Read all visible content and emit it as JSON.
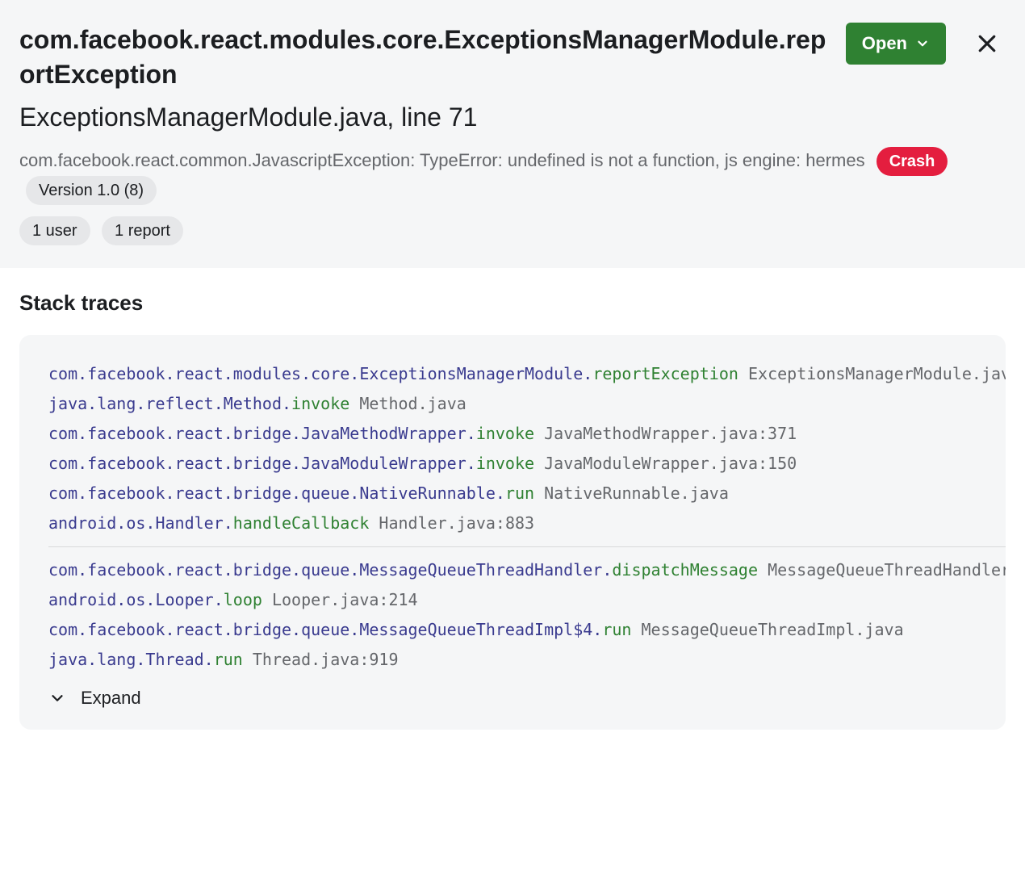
{
  "header": {
    "title": "com.facebook.react.modules.core.ExceptionsManagerModule.reportException",
    "location": "ExceptionsManagerModule.java, line 71",
    "description": "com.facebook.react.common.JavascriptException: TypeError: undefined is not a function, js engine: hermes",
    "status_button": "Open",
    "badges": {
      "crash": "Crash",
      "version": "Version 1.0 (8)"
    },
    "meta": {
      "users": "1 user",
      "reports": "1 report"
    }
  },
  "stack": {
    "heading": "Stack traces",
    "expand_label": "Expand",
    "frames_top": [
      {
        "pkg": "com.facebook.react.modules.core.ExceptionsManagerModule",
        "method": "reportException",
        "src": "ExceptionsManagerModule.java"
      },
      {
        "pkg": "java.lang.reflect.Method",
        "method": "invoke",
        "src": "Method.java"
      },
      {
        "pkg": "com.facebook.react.bridge.JavaMethodWrapper",
        "method": "invoke",
        "src": "JavaMethodWrapper.java:371"
      },
      {
        "pkg": "com.facebook.react.bridge.JavaModuleWrapper",
        "method": "invoke",
        "src": "JavaModuleWrapper.java:150"
      },
      {
        "pkg": "com.facebook.react.bridge.queue.NativeRunnable",
        "method": "run",
        "src": "NativeRunnable.java"
      },
      {
        "pkg": "android.os.Handler",
        "method": "handleCallback",
        "src": "Handler.java:883"
      }
    ],
    "frames_bottom": [
      {
        "pkg": "com.facebook.react.bridge.queue.MessageQueueThreadHandler",
        "method": "dispatchMessage",
        "src": "MessageQueueThreadHandler.java"
      },
      {
        "pkg": "android.os.Looper",
        "method": "loop",
        "src": "Looper.java:214"
      },
      {
        "pkg": "com.facebook.react.bridge.queue.MessageQueueThreadImpl$4",
        "method": "run",
        "src": "MessageQueueThreadImpl.java"
      },
      {
        "pkg": "java.lang.Thread",
        "method": "run",
        "src": "Thread.java:919"
      }
    ]
  }
}
